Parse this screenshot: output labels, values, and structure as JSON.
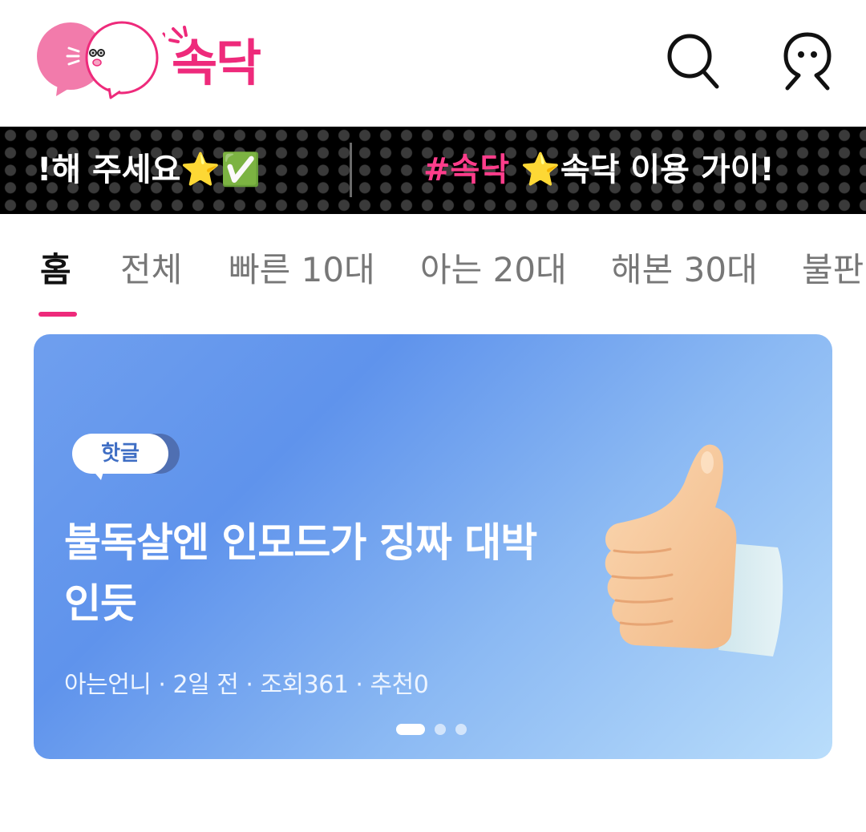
{
  "app": {
    "logo_text": "속닥"
  },
  "header": {
    "search_icon": "search-icon",
    "profile_icon": "profile-icon"
  },
  "ticker": {
    "items": [
      {
        "text": "!해 주세요⭐✅"
      },
      {
        "tag": "#속닥",
        "text": " ⭐속닥 이용 가이!"
      }
    ]
  },
  "tabs": [
    {
      "label": "홈",
      "active": true
    },
    {
      "label": "전체"
    },
    {
      "label": "빠른 10대"
    },
    {
      "label": "아는 20대"
    },
    {
      "label": "해본 30대"
    },
    {
      "label": "불판"
    }
  ],
  "banner": {
    "badge": "핫글",
    "title": "불독살엔 인모드가 징짜 대박인듯",
    "meta": "아는언니 · 2일 전 · 조회361 · 추천0",
    "image_icon": "thumbs-up-icon",
    "pager": {
      "current": 1,
      "total": 3
    }
  },
  "colors": {
    "brand_pink": "#ee2a7b",
    "ticker_tag": "#ff3d8b",
    "banner_start": "#6f9fee",
    "banner_end": "#b9ddfb"
  }
}
